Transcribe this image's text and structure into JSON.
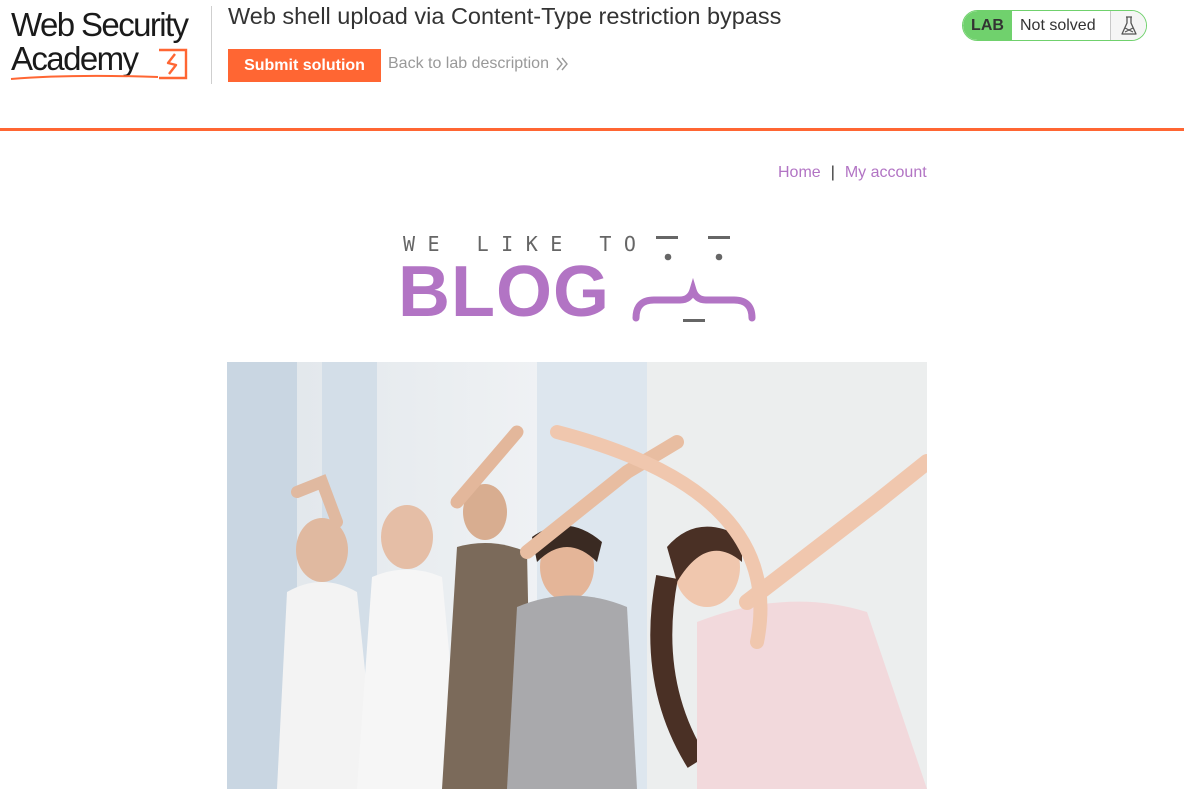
{
  "academy": {
    "logo_line1": "Web Security",
    "logo_line2": "Academy",
    "lab_title": "Web shell upload via Content-Type restriction bypass",
    "submit_label": "Submit solution",
    "back_label": "Back to lab description",
    "lab_badge": "LAB",
    "lab_status": "Not solved",
    "colors": {
      "accent": "#ff6633",
      "lab_green": "#70d16d"
    }
  },
  "blog": {
    "nav": {
      "home": "Home",
      "separator": "|",
      "account": "My account"
    },
    "tagline": "WE LIKE TO",
    "brand": "BLOG",
    "colors": {
      "brand_purple": "#b274c4"
    },
    "hero_image_icon": "fitness-class-photo"
  }
}
